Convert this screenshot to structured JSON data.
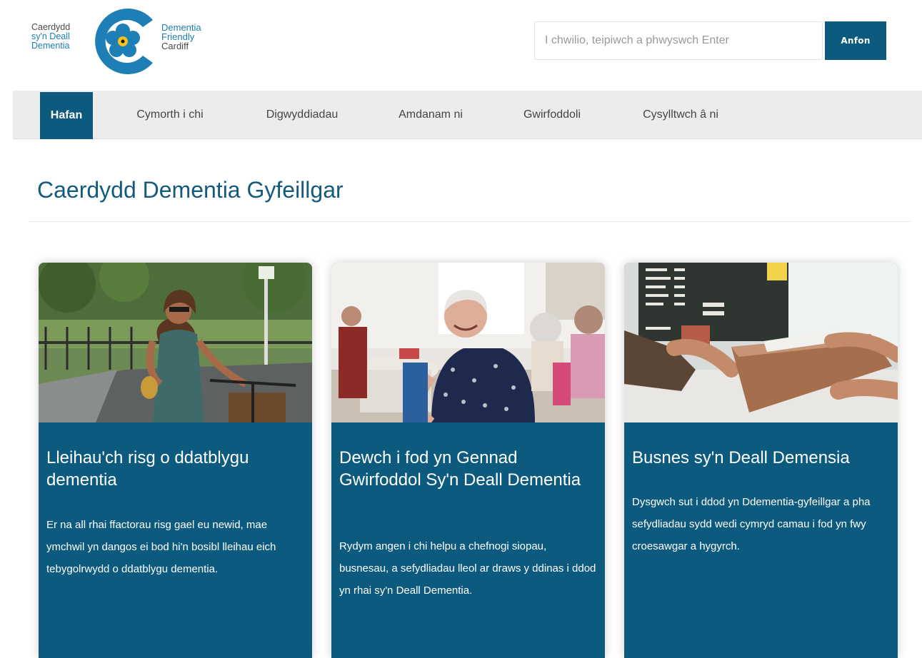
{
  "logo": {
    "cy_lines": [
      "Caerdydd",
      "sy'n Deall",
      "Dementia"
    ],
    "en_lines": [
      "Dementia",
      "Friendly",
      "Cardiff"
    ]
  },
  "search": {
    "placeholder": "I chwilio, teipiwch a phwyswch Enter",
    "button_label": "Anfon"
  },
  "nav": {
    "items": [
      {
        "label": "Hafan",
        "active": true
      },
      {
        "label": "Cymorth i chi",
        "active": false
      },
      {
        "label": "Digwyddiadau",
        "active": false
      },
      {
        "label": "Amdanam ni",
        "active": false
      },
      {
        "label": "Gwirfoddoli",
        "active": false
      },
      {
        "label": "Cysylltwch â ni",
        "active": false
      }
    ]
  },
  "page": {
    "title": "Caerdydd Dementia Gyfeillgar"
  },
  "cards": [
    {
      "title": "Lleihau'ch risg o ddatblygu dementia",
      "text": "Er na all rhai ffactorau risg gael eu newid, mae ymchwil yn dangos ei bod hi'n bosibl lleihau eich tebygolrwydd o ddatblygu dementia."
    },
    {
      "title": "Dewch i fod yn Gennad Gwirfoddol Sy'n Deall Dementia",
      "text": "Rydym angen i chi helpu a chefnogi siopau, busnesau, a sefydliadau lleol ar draws y ddinas i ddod yn rhai sy'n Deall Dementia."
    },
    {
      "title": "Busnes sy'n Deall Demensia",
      "text": "Dysgwch sut i ddod yn Ddementia-gyfeillgar a pha sefydliadau sydd wedi cymryd camau i fod yn fwy croesawgar a hygyrch."
    }
  ],
  "colors": {
    "brand_blue": "#0c5a7e",
    "title_blue": "#14597e",
    "nav_bg": "#ececec"
  }
}
